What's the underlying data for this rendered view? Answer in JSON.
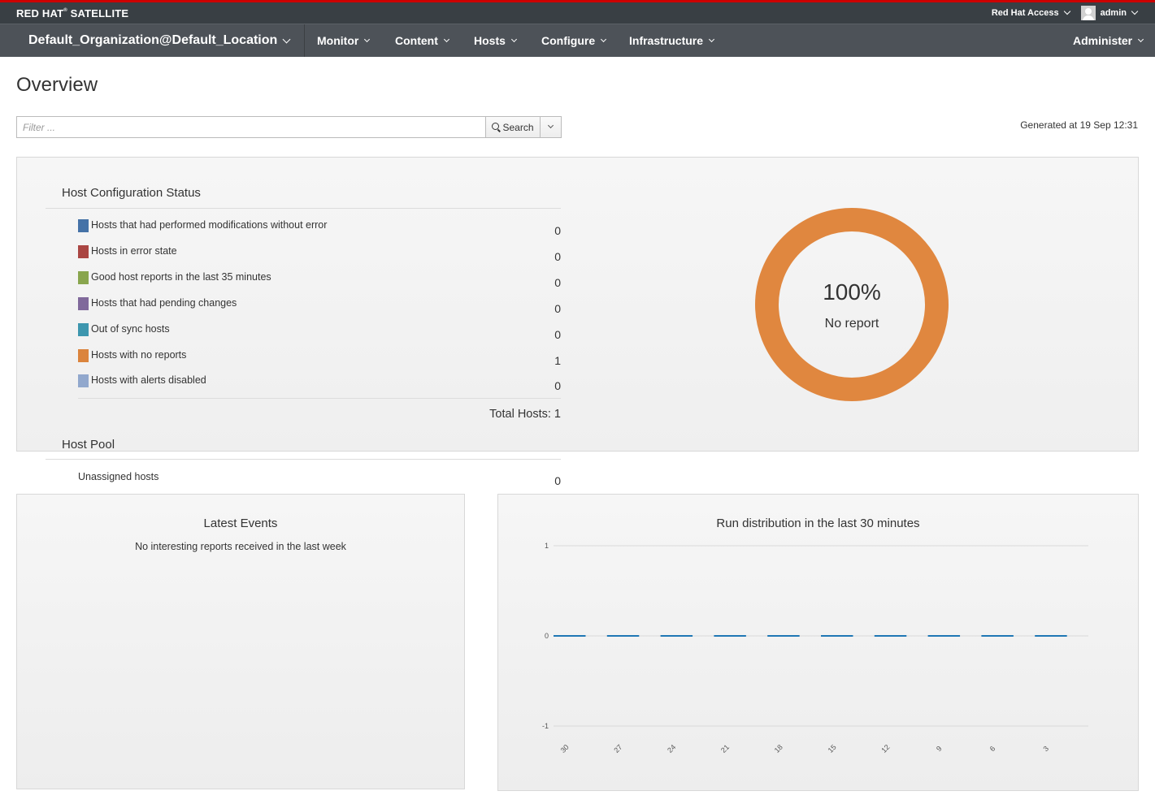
{
  "colors": {
    "brand_red": "#cc0000",
    "topbar": "#393f44",
    "navbar": "#4d5258",
    "no_report": "#e0873f",
    "run_line": "#1f77b4"
  },
  "header": {
    "brand": "RED HAT",
    "brand_mark": "®",
    "brand_product": "SATELLITE",
    "access": "Red Hat Access",
    "user": "admin"
  },
  "nav": {
    "org": "Default_Organization@Default_Location",
    "items": [
      "Monitor",
      "Content",
      "Hosts",
      "Configure",
      "Infrastructure"
    ],
    "admin": "Administer"
  },
  "page": {
    "title": "Overview",
    "filter_placeholder": "Filter ...",
    "search_label": "Search",
    "generated": "Generated at 19 Sep 12:31"
  },
  "host_config": {
    "title": "Host Configuration Status",
    "rows": [
      {
        "label": "Hosts that had performed modifications without error",
        "value": "0",
        "color": "#4572a7"
      },
      {
        "label": "Hosts in error state",
        "value": "0",
        "color": "#aa4643"
      },
      {
        "label": "Good host reports in the last 35 minutes",
        "value": "0",
        "color": "#89a54e"
      },
      {
        "label": "Hosts that had pending changes",
        "value": "0",
        "color": "#80699b"
      },
      {
        "label": "Out of sync hosts",
        "value": "0",
        "color": "#3d96ae"
      },
      {
        "label": "Hosts with no reports",
        "value": "1",
        "color": "#db843d"
      },
      {
        "label": "Hosts with alerts disabled",
        "value": "0",
        "color": "#92a8cd"
      }
    ],
    "total": "Total Hosts: 1",
    "donut_pct": "100%",
    "donut_label": "No report"
  },
  "host_pool": {
    "title": "Host Pool",
    "label": "Unassigned hosts",
    "value": "0"
  },
  "events": {
    "title": "Latest Events",
    "message": "No interesting reports received in the last week"
  },
  "chart_data": {
    "type": "bar",
    "title": "Run distribution in the last 30 minutes",
    "categories": [
      "30",
      "27",
      "24",
      "21",
      "18",
      "15",
      "12",
      "9",
      "6",
      "3"
    ],
    "values": [
      0,
      0,
      0,
      0,
      0,
      0,
      0,
      0,
      0,
      0
    ],
    "ylim": [
      -1,
      1
    ],
    "yticks": [
      "1",
      "0",
      "-1"
    ],
    "grid": true
  }
}
